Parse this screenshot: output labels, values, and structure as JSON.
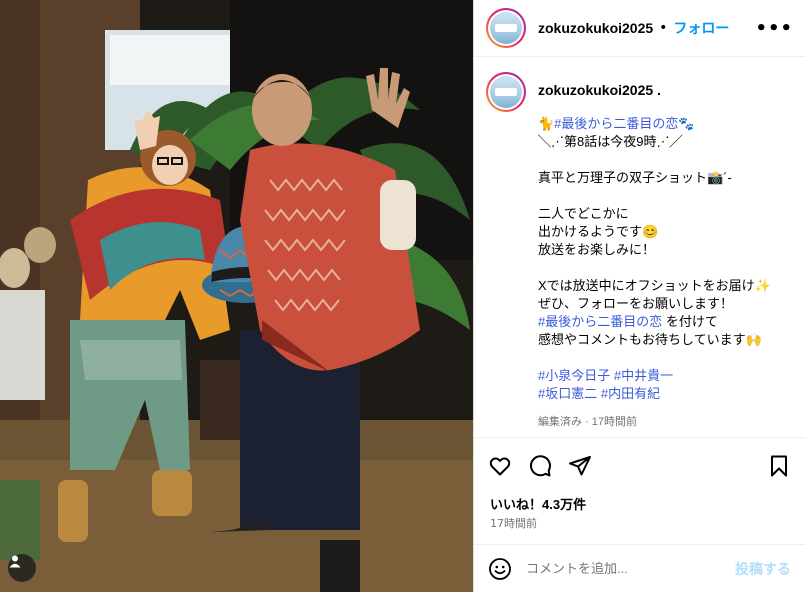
{
  "post": {
    "username": "zokuzokukoi2025",
    "follow_label": "フォロー",
    "dot": "•",
    "more_label": "•••",
    "caption_user": "zokuzokukoi2025 .",
    "caption_lines": [
      {
        "text": "🐈#最後から二番目の恋🐾",
        "type": "tag"
      },
      {
        "text": "╲⋰第8話は今夜9時⋰╱",
        "type": "text"
      },
      {
        "text": "",
        "type": "gap"
      },
      {
        "text": "真平と万理子の双子ショット📸´-",
        "type": "text"
      },
      {
        "text": "",
        "type": "gap"
      },
      {
        "text": "二人でどこかに",
        "type": "text"
      },
      {
        "text": "出かけるようです😊",
        "type": "text"
      },
      {
        "text": "放送をお楽しみに！",
        "type": "text"
      },
      {
        "text": "",
        "type": "gap"
      },
      {
        "text": "Xでは放送中にオフショットをお届け✨",
        "type": "text"
      },
      {
        "text": "ぜひ、フォローをお願いします！",
        "type": "text"
      },
      {
        "text": "#最後から二番目の恋 を付けて",
        "type": "mixed",
        "tag": "#最後から二番目の恋",
        "rest": " を付けて"
      },
      {
        "text": "感想やコメントもお待ちしています🙌",
        "type": "text"
      },
      {
        "text": "",
        "type": "gap"
      },
      {
        "text": "#小泉今日子 #中井貴一",
        "type": "tag"
      },
      {
        "text": "#坂口憲二 #内田有紀",
        "type": "tag"
      }
    ],
    "meta": "編集済み · 17時間前",
    "likes": "いいね！4.3万件",
    "time": "17時間前",
    "comment_placeholder": "コメントを追加...",
    "post_button": "投稿する"
  },
  "icons": [
    "heart-icon",
    "comment-icon",
    "share-icon",
    "bookmark-icon",
    "emoji-icon",
    "user-tag-icon"
  ],
  "colors": {
    "accent": "#0095f6",
    "hashtag": "#3b5bdb",
    "muted": "#737373",
    "post_disabled": "#b2dffc"
  }
}
